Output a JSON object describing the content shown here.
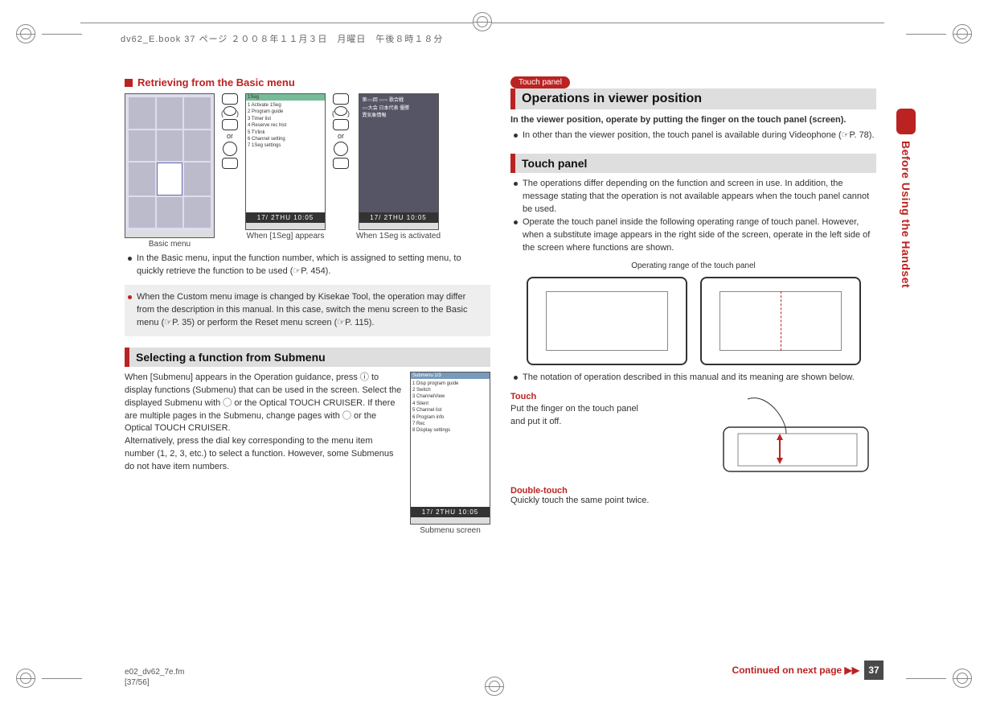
{
  "header": {
    "file_line": "dv62_E.book  37 ページ  ２００８年１１月３日　月曜日　午後８時１８分"
  },
  "side_tab": "Before Using the Handset",
  "left": {
    "section_title": "Retrieving from the Basic menu",
    "seg_menu_header": "1Seg",
    "seg_menu_items": [
      "1 Activate 1Seg",
      "2 Program guide",
      "3 Timer list",
      "4 Reserve rec hist",
      "5 TVlink",
      "6 Channel setting",
      "7 1Seg settings"
    ],
    "clock": "17/ 2THU 10:05",
    "caption_basic": "Basic menu",
    "caption_1seg_appears": "When [1Seg] appears",
    "caption_1seg_activated": "When 1Seg is activated",
    "key_or": "or",
    "bullet1": "In the Basic menu, input the function number, which is assigned to setting menu, to quickly retrieve the function to be used (☞P. 454).",
    "note": "When the Custom menu image is changed by Kisekae Tool, the operation may differ from the description in this manual. In this case, switch the menu screen to the Basic menu (☞P. 35) or perform the Reset menu screen (☞P. 115).",
    "sub_heading": "Selecting a function from Submenu",
    "sub_text": "When [Submenu] appears in the Operation guidance, press ⓘ to display functions (Submenu) that can be used in the screen. Select the displayed Submenu with ◯ or the Optical TOUCH CRUISER. If there are multiple pages in the Submenu, change pages with ◯ or the Optical TOUCH CRUISER.\nAlternatively, press the dial key corresponding to the menu item number (1, 2, 3, etc.) to select a function. However, some Submenus do not have item numbers.",
    "submenu_header": "Submenu        1/3",
    "submenu_caption": "Submenu screen",
    "submenu_items": [
      "1 Disp program guide",
      "2 Switch",
      "3 ChannelView",
      "4 Silent",
      "5 Channel list",
      "6 Program info",
      "7 Rec",
      "8 Display settings"
    ]
  },
  "right": {
    "pill": "Touch panel",
    "main_heading": "Operations in viewer position",
    "intro": "In the viewer position, operate by putting the finger on the touch panel (screen).",
    "intro_bullet": "In other than the viewer position, the touch panel is available during Videophone (☞P. 78).",
    "sub_heading": "Touch panel",
    "bullets": [
      "The operations differ depending on the function and screen in use. In addition, the message stating that the operation is not available appears when the touch panel cannot be used.",
      "Operate the touch panel inside the following operating range of touch panel. However, when a substitute image appears in the right side of the screen, operate in the left side of the screen where functions are shown."
    ],
    "op_range_label": "Operating range of the touch panel",
    "notation_bullet": "The notation of operation described in this manual and its meaning are shown below.",
    "touch_label": "Touch",
    "touch_desc": "Put the finger on the touch panel and put it off.",
    "double_touch_label": "Double-touch",
    "double_touch_desc": "Quickly touch the same point twice."
  },
  "footer": {
    "continued": "Continued on next page ▶▶",
    "page_number": "37",
    "file_name": "e02_dv62_7e.fm",
    "file_page": "[37/56]"
  }
}
